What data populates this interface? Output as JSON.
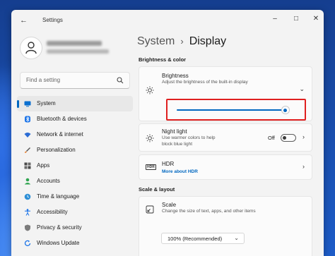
{
  "window": {
    "title": "Settings"
  },
  "profile": {},
  "search": {
    "placeholder": "Find a setting"
  },
  "sidebar": {
    "items": [
      {
        "label": "System",
        "icon": "monitor-icon",
        "active": true
      },
      {
        "label": "Bluetooth & devices",
        "icon": "bluetooth-icon"
      },
      {
        "label": "Network & internet",
        "icon": "wifi-icon"
      },
      {
        "label": "Personalization",
        "icon": "brush-icon"
      },
      {
        "label": "Apps",
        "icon": "apps-icon"
      },
      {
        "label": "Accounts",
        "icon": "person-icon"
      },
      {
        "label": "Time & language",
        "icon": "globe-clock-icon"
      },
      {
        "label": "Accessibility",
        "icon": "accessibility-icon"
      },
      {
        "label": "Privacy & security",
        "icon": "shield-icon"
      },
      {
        "label": "Windows Update",
        "icon": "update-icon"
      }
    ]
  },
  "main": {
    "breadcrumb_parent": "System",
    "breadcrumb_separator": "›",
    "page_title": "Display",
    "brightness_section": "Brightness & color",
    "brightness": {
      "title": "Brightness",
      "subtitle": "Adjust the brightness of the built-in display",
      "level": 0.96
    },
    "night_light": {
      "title": "Night light",
      "subtitle_line1": "Use warmer colors to help",
      "subtitle_line2": "block blue light",
      "state": "Off"
    },
    "hdr": {
      "title": "HDR",
      "link": "More about HDR",
      "icon_text": "HDR"
    },
    "scale_section": "Scale & layout",
    "scale": {
      "title": "Scale",
      "subtitle": "Change the size of text, apps, and other items",
      "value": "100% (Recommended)"
    }
  },
  "colors": {
    "accent": "#0067c0",
    "highlight": "#e02020"
  }
}
